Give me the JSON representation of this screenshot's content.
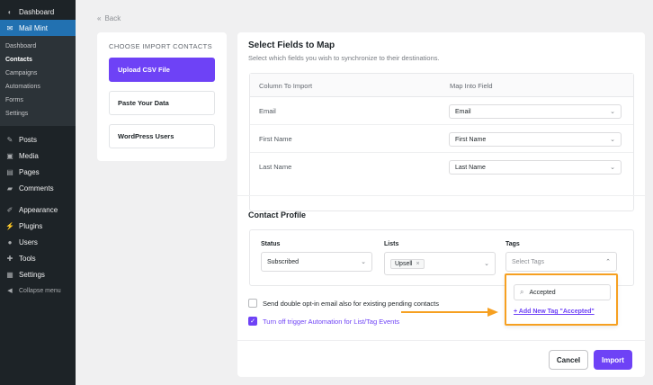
{
  "sidebar": {
    "top": [
      {
        "label": "Dashboard",
        "icon": "dashboard-icon"
      },
      {
        "label": "Mail Mint",
        "icon": "mail-icon"
      }
    ],
    "sub": [
      "Dashboard",
      "Contacts",
      "Campaigns",
      "Automations",
      "Forms",
      "Settings"
    ],
    "items": [
      {
        "label": "Posts",
        "icon": "pin-icon"
      },
      {
        "label": "Media",
        "icon": "media-icon"
      },
      {
        "label": "Pages",
        "icon": "page-icon"
      },
      {
        "label": "Comments",
        "icon": "comment-icon"
      },
      {
        "label": "Appearance",
        "icon": "brush-icon"
      },
      {
        "label": "Plugins",
        "icon": "plugin-icon"
      },
      {
        "label": "Users",
        "icon": "user-icon"
      },
      {
        "label": "Tools",
        "icon": "wrench-icon"
      },
      {
        "label": "Settings",
        "icon": "settings-icon"
      },
      {
        "label": "Collapse menu",
        "icon": "collapse-icon"
      }
    ]
  },
  "back_label": "Back",
  "import_panel": {
    "heading": "CHOOSE IMPORT CONTACTS",
    "options": [
      "Upload CSV File",
      "Paste Your Data",
      "WordPress Users"
    ]
  },
  "map": {
    "title": "Select Fields to Map",
    "subtitle": "Select which fields you wish to synchronize to their destinations.",
    "col1": "Column To Import",
    "col2": "Map Into Field",
    "rows": [
      {
        "column": "Email",
        "field": "Email"
      },
      {
        "column": "First Name",
        "field": "First Name"
      },
      {
        "column": "Last Name",
        "field": "Last Name"
      }
    ]
  },
  "profile": {
    "title": "Contact Profile",
    "status_label": "Status",
    "status_value": "Subscribed",
    "lists_label": "Lists",
    "lists_chip": "Upsell",
    "tags_label": "Tags",
    "tags_placeholder": "Select Tags"
  },
  "tag_popup": {
    "search_value": "Accepted",
    "add_link": "+ Add New Tag \"Accepted\""
  },
  "options": {
    "double_optin": "Send double opt-in email also for existing pending contacts",
    "turn_off": "Turn off trigger Automation for List/Tag Events"
  },
  "buttons": {
    "cancel": "Cancel",
    "import": "Import"
  },
  "colors": {
    "accent": "#6e42f6",
    "highlight": "#f6a021",
    "sidebar": "#1d2327",
    "active": "#2271b1"
  }
}
